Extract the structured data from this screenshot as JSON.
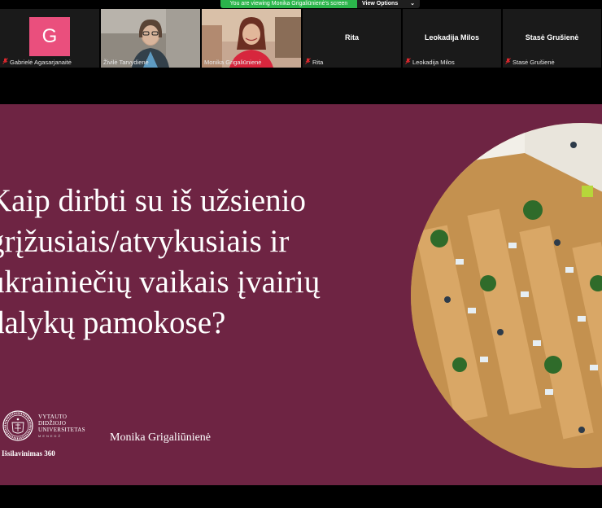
{
  "banner": {
    "viewing_text": "You are viewing Monika Grigaliūnienė's screen",
    "view_options_label": "View Options",
    "chevron_icon": "chevron-down-icon"
  },
  "participants": [
    {
      "name": "Gabrielė Agasarjanaitė",
      "avatar_letter": "G",
      "avatar_color": "#ea4f7d",
      "muted": true
    },
    {
      "name": "Živilė Tarvydienė",
      "muted": false,
      "video": true
    },
    {
      "name": "Monika Grigaliūnienė",
      "muted": false,
      "video": true,
      "active_speaker": true
    },
    {
      "name": "Rita",
      "display_name": "Rita",
      "muted": true
    },
    {
      "name": "Leokadija Milos",
      "display_name": "Leokadija Milos",
      "muted": true
    },
    {
      "name": "Stasė Grušienė",
      "display_name": "Stasė Grušienė",
      "muted": true
    }
  ],
  "slide": {
    "title_lines": [
      "Kaip dirbti su iš užsienio",
      "grįžusiais/atvykusiais ir",
      "ukrainiečių vaikais įvairių",
      "dalykų pamokose?"
    ],
    "presenter": "Monika Grigaliūnienė",
    "logo_lines": [
      "VYTAUTO",
      "DIDŽIOJO",
      "UNIVERSITETAS"
    ],
    "logo_sub": "MENEDŽ",
    "tagline": "Išsilavinimas 360",
    "background_color": "#6e2443"
  }
}
